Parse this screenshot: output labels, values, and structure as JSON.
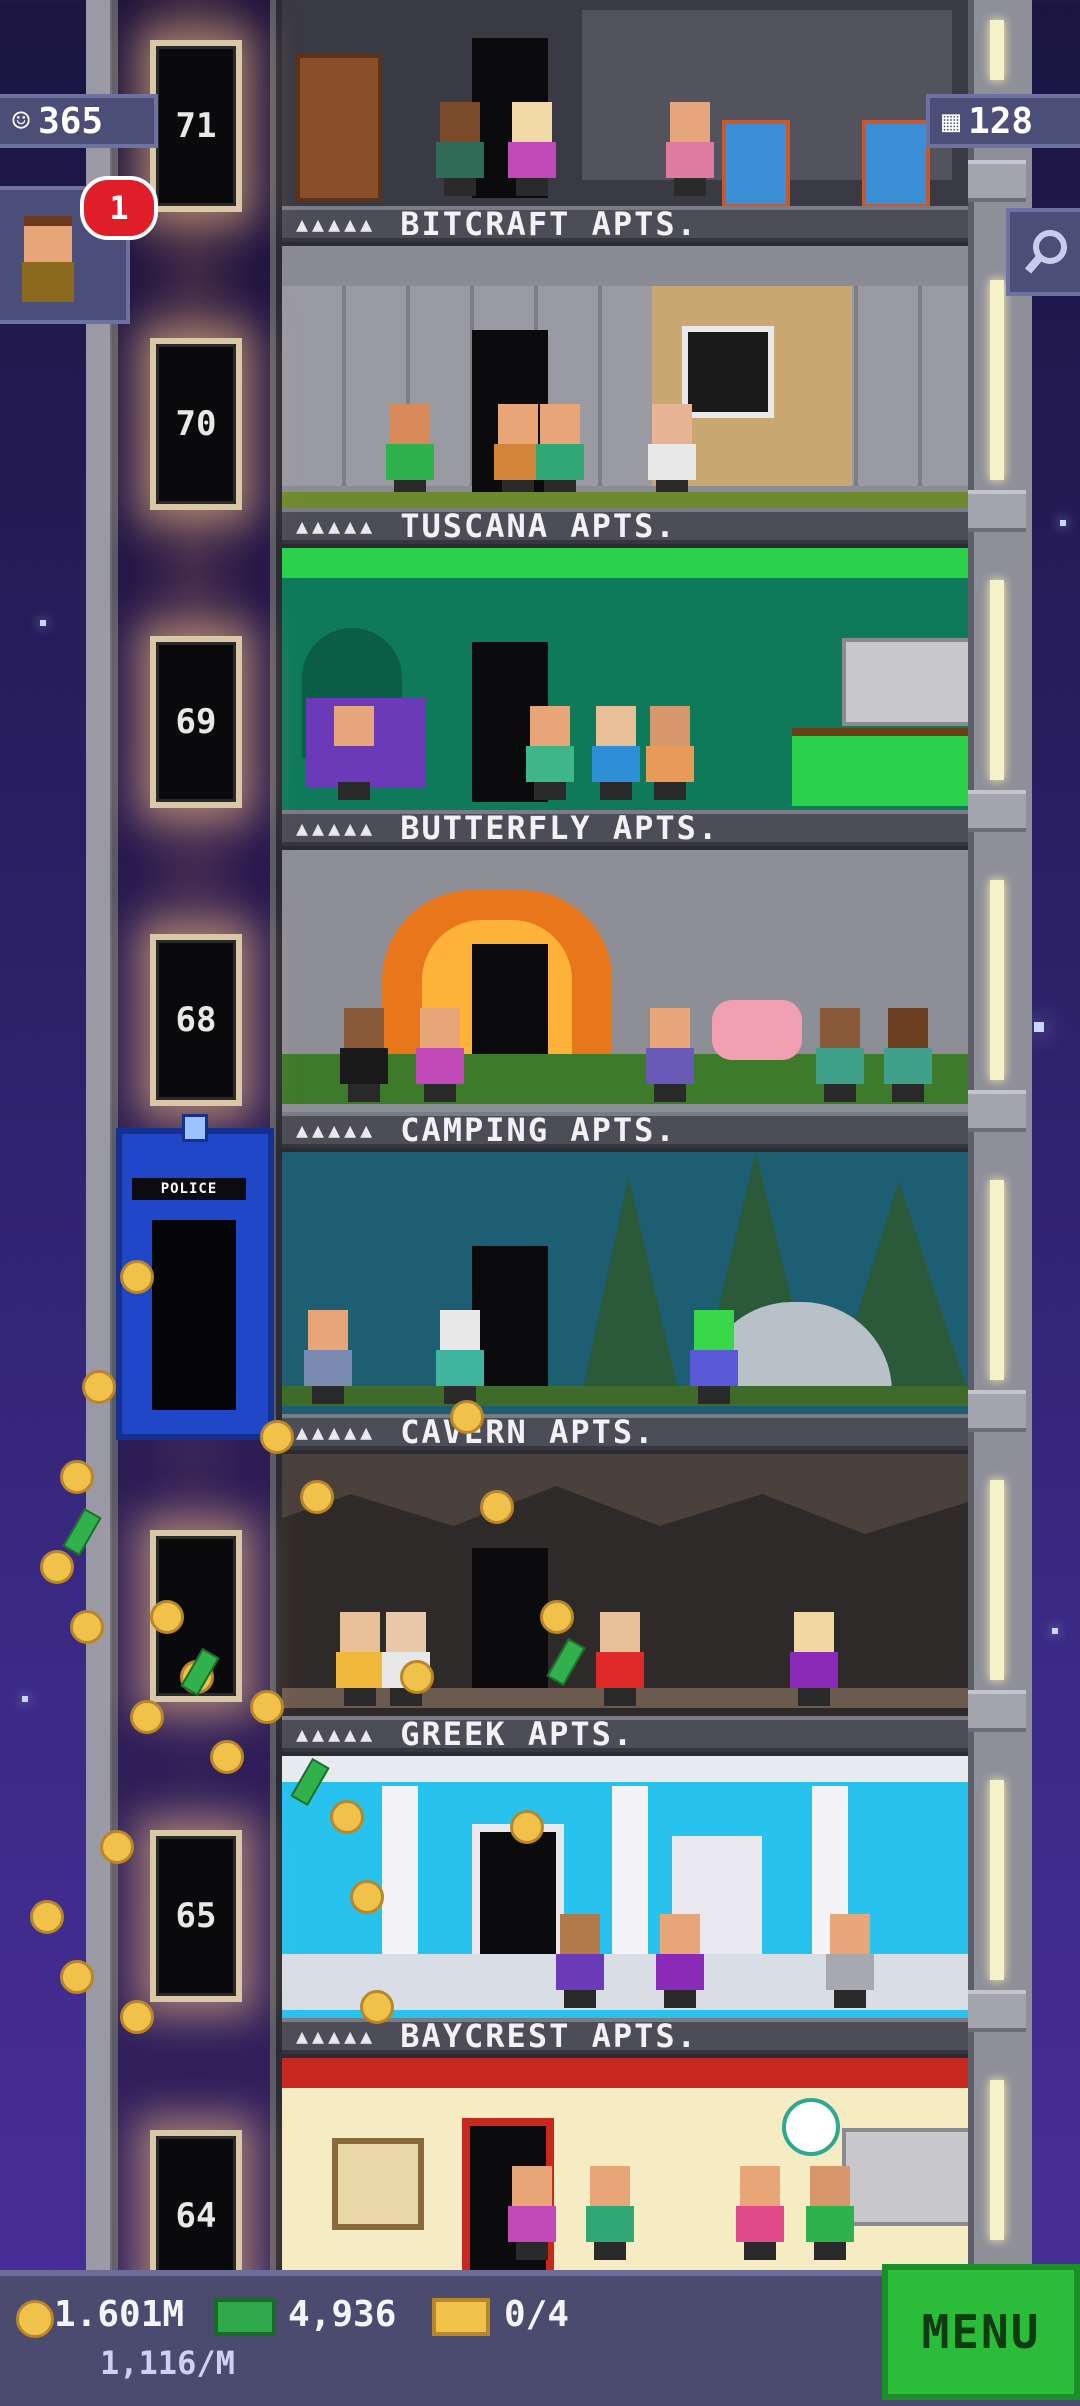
{
  "hud": {
    "population": "365",
    "floor_count": "128",
    "notification_count": "1"
  },
  "floors": [
    {
      "name": "BITCRAFT APTS.",
      "pips": "▲▲▲▲▲"
    },
    {
      "name": "TUSCANA APTS.",
      "pips": "▲▲▲▲▲"
    },
    {
      "name": "BUTTERFLY APTS.",
      "pips": "▲▲▲▲▲"
    },
    {
      "name": "CAMPING APTS.",
      "pips": "▲▲▲▲▲"
    },
    {
      "name": "CAVERN APTS.",
      "pips": "▲▲▲▲▲"
    },
    {
      "name": "GREEK APTS.",
      "pips": "▲▲▲▲▲"
    },
    {
      "name": "BAYCREST APTS.",
      "pips": "▲▲▲▲▲"
    }
  ],
  "elevator_floors": [
    "71",
    "70",
    "69",
    "68",
    "65",
    "64"
  ],
  "police_box_sign": "POLICE",
  "bottom_bar": {
    "coins": "1.601M",
    "coins_rate": "1,116/M",
    "bux": "4,936",
    "tickets": "0/4",
    "menu_label": "MENU"
  },
  "colors": {
    "menu_green": "#2bbd3a",
    "hud_panel": "#4b4f78",
    "badge_red": "#e01e2a"
  },
  "icons": [
    "people-icon",
    "floors-icon",
    "search-icon",
    "coin-icon",
    "bux-icon",
    "ticket-icon"
  ]
}
